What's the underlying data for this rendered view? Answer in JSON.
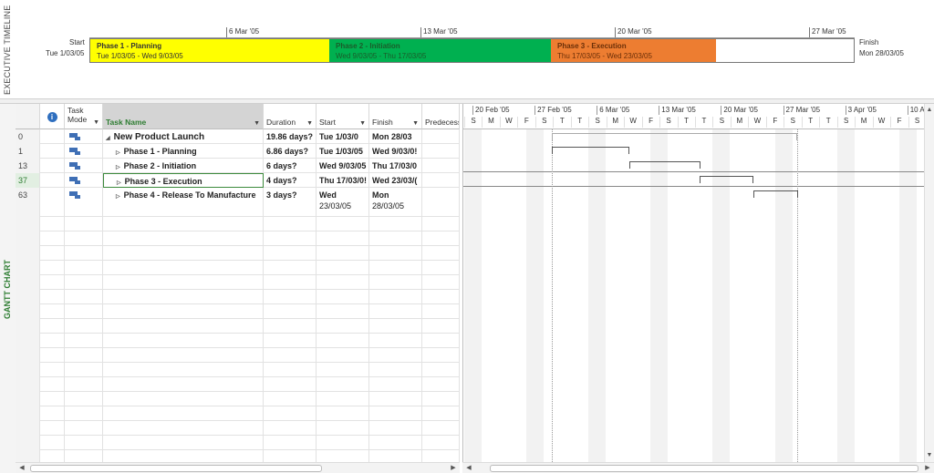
{
  "timeline": {
    "side_label": "EXECUTIVE TIMELINE",
    "start_label": "Start",
    "start_date": "Tue 1/03/05",
    "finish_label": "Finish",
    "finish_date": "Mon 28/03/05",
    "ticks": [
      "6 Mar '05",
      "13 Mar '05",
      "20 Mar '05",
      "27 Mar '05"
    ],
    "phases": [
      {
        "name": "Phase 1 - Planning",
        "dates": "Tue 1/03/05 - Wed 9/03/05",
        "color": "#ffff00"
      },
      {
        "name": "Phase 2 - Initiation",
        "dates": "Wed 9/03/05 - Thu 17/03/05",
        "color": "#00b050"
      },
      {
        "name": "Phase 3 - Execution",
        "dates": "Thu 17/03/05 - Wed 23/03/05",
        "color": "#ed7d31"
      }
    ]
  },
  "gantt": {
    "side_label": "GANTT CHART",
    "headers": {
      "info": "i",
      "mode": "Task Mode",
      "name": "Task Name",
      "duration": "Duration",
      "start": "Start",
      "finish": "Finish",
      "pred": "Predecess"
    },
    "rows": [
      {
        "id": "0",
        "toggle": "◢",
        "name": "New Product Launch",
        "duration": "19.86 days?",
        "start": "Tue 1/03/0",
        "finish": "Mon 28/03",
        "bold": true,
        "indent": 0
      },
      {
        "id": "1",
        "toggle": "▷",
        "name": "Phase 1 - Planning",
        "duration": "6.86 days?",
        "start": "Tue 1/03/05",
        "finish": "Wed 9/03/0!",
        "bold": true,
        "indent": 1
      },
      {
        "id": "13",
        "toggle": "▷",
        "name": "Phase 2 - Initiation",
        "duration": "6 days?",
        "start": "Wed 9/03/05",
        "finish": "Thu 17/03/0",
        "bold": true,
        "indent": 1
      },
      {
        "id": "37",
        "toggle": "▷",
        "name": "Phase 3 - Execution",
        "duration": "4 days?",
        "start": "Thu 17/03/0!",
        "finish": "Wed 23/03/(",
        "bold": true,
        "indent": 1
      },
      {
        "id": "63",
        "toggle": "▷",
        "name": "Phase 4 - Release To Manufacture",
        "duration": "3 days?",
        "start": "Wed",
        "start2": "23/03/05",
        "finish": "Mon",
        "finish2": "28/03/05",
        "bold": true,
        "indent": 1
      }
    ],
    "weeks": [
      "20 Feb '05",
      "27 Feb '05",
      "6 Mar '05",
      "13 Mar '05",
      "20 Mar '05",
      "27 Mar '05",
      "3 Apr '05",
      "10 A"
    ],
    "days": [
      "S",
      "M",
      "W",
      "F",
      "S",
      "T",
      "T",
      "S",
      "M",
      "W",
      "F",
      "S",
      "T",
      "T",
      "S",
      "M",
      "W",
      "F",
      "S",
      "T",
      "T",
      "S",
      "M",
      "W",
      "F",
      "S",
      "T",
      "T",
      "S",
      "M",
      "W",
      "F",
      "S",
      "T",
      "T",
      "S",
      "M",
      "W",
      "F",
      "S",
      "T",
      "T"
    ]
  },
  "colors": {
    "selected_row_border": "#3c8a3c",
    "header_sort_bg": "#d4d4d4",
    "gantt_label": "#2e7d32"
  }
}
